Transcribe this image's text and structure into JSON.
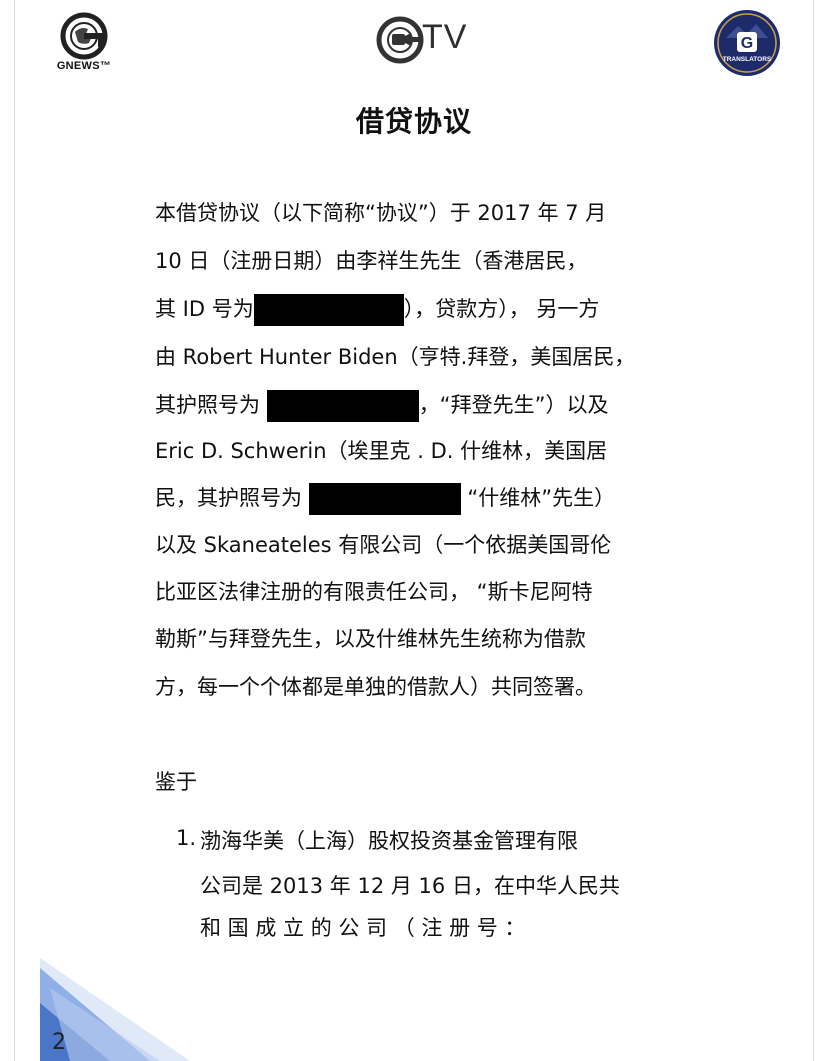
{
  "header": {
    "left_logo_text": "GNEWS™",
    "center_logo_text": "TV",
    "right_logo_text": "TRANSLATORS"
  },
  "document": {
    "title": "借贷协议",
    "paragraph_lines": [
      "本借贷协议（以下简称“协议”）于 2017 年 7 月",
      "10 日（注册日期）由李祥生先生（香港居民，",
      [
        "其 ID 号为",
        "），贷款方）， 另一方"
      ],
      "由 Robert Hunter Biden（亨特.拜登，美国居民，",
      [
        "其护照号为",
        "，“拜登先生”）以及"
      ],
      "Eric D. Schwerin（埃里克 . D. 什维林，美国居",
      [
        "民，其护照号为",
        "“什维林”先生）"
      ],
      "以及 Skaneateles 有限公司（一个依据美国哥伦",
      "比亚区法律注册的有限责任公司， “斯卡尼阿特",
      "勒斯”与拜登先生，以及什维林先生统称为借款",
      "方，每一个个体都是单独的借款人）共同签署。"
    ],
    "section_heading": "鉴于",
    "list_item_number": "1.",
    "list_item_lines": [
      "渤海华美（上海）股权投资基金管理有限",
      "公司是 2013 年 12 月 16 日，在中华人民共",
      "和  国  成  立  的  公  司  （  注  册  号  ："
    ]
  },
  "footer": {
    "page_number": "2"
  },
  "colors": {
    "redaction": "#000000",
    "corner_blue": "#4a76c8",
    "text": "#111111"
  }
}
